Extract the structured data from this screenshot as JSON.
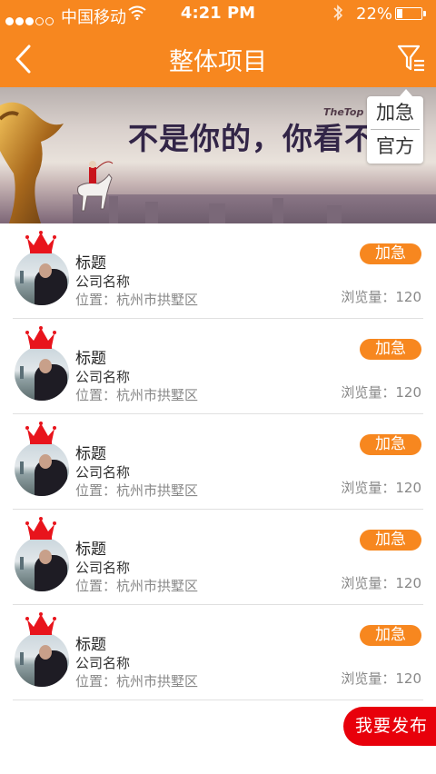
{
  "status_bar": {
    "carrier": "中国移动",
    "time": "4:21 PM",
    "battery_pct": "22%",
    "battery_level": 0.22,
    "signal_dots_filled": 3,
    "signal_dots_total": 5,
    "icons": [
      "wifi-icon",
      "bluetooth-icon",
      "battery-icon"
    ]
  },
  "nav": {
    "title": "整体项目",
    "icons": [
      "back-chevron-icon",
      "filter-icon"
    ]
  },
  "banner": {
    "slogan": "不是你的，你看不见",
    "brand": "TheTop"
  },
  "filter_menu": {
    "options": [
      "加急",
      "官方"
    ]
  },
  "list": [
    {
      "title": "标题",
      "company": "公司名称",
      "location_label": "位置：",
      "location": "杭州市拱墅区",
      "badge": "加急",
      "views_label": "浏览量：",
      "views": "120"
    },
    {
      "title": "标题",
      "company": "公司名称",
      "location_label": "位置：",
      "location": "杭州市拱墅区",
      "badge": "加急",
      "views_label": "浏览量：",
      "views": "120"
    },
    {
      "title": "标题",
      "company": "公司名称",
      "location_label": "位置：",
      "location": "杭州市拱墅区",
      "badge": "加急",
      "views_label": "浏览量：",
      "views": "120"
    },
    {
      "title": "标题",
      "company": "公司名称",
      "location_label": "位置：",
      "location": "杭州市拱墅区",
      "badge": "加急",
      "views_label": "浏览量：",
      "views": "120"
    },
    {
      "title": "标题",
      "company": "公司名称",
      "location_label": "位置：",
      "location": "杭州市拱墅区",
      "badge": "加急",
      "views_label": "浏览量：",
      "views": "120"
    }
  ],
  "publish_button": "我要发布",
  "colors": {
    "brand_orange": "#f7871f",
    "publish_red": "#e8000b",
    "crown_red": "#e8141c"
  }
}
